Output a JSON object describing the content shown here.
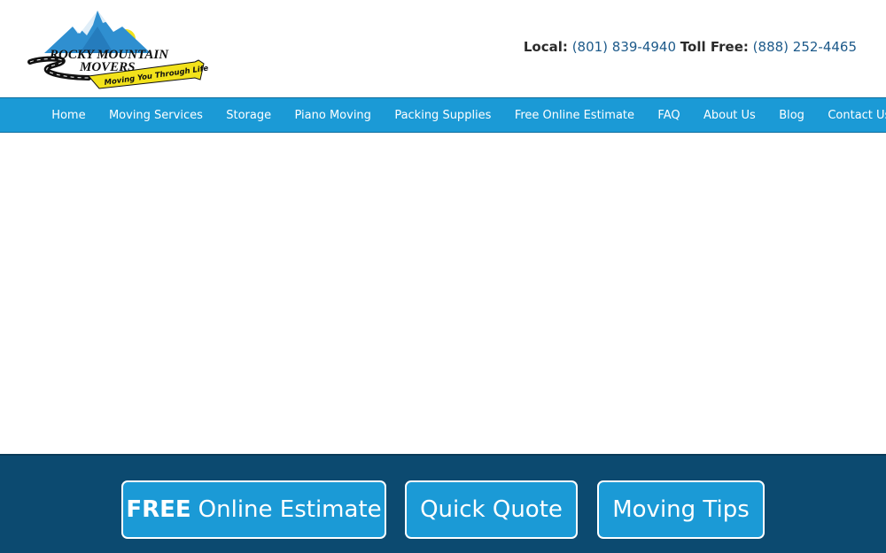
{
  "brand": {
    "logo_line1": "ROCKY MOUNTAIN",
    "logo_line2": "MOVERS",
    "tagline": "Moving You Through Life!"
  },
  "contact": {
    "local_label": "Local:",
    "local_number": "(801) 839-4940",
    "tollfree_label": "Toll Free:",
    "tollfree_number": "(888) 252-4465"
  },
  "nav": {
    "items": [
      {
        "label": "Home"
      },
      {
        "label": "Moving Services"
      },
      {
        "label": "Storage"
      },
      {
        "label": "Piano Moving"
      },
      {
        "label": "Packing Supplies"
      },
      {
        "label": "Free Online Estimate"
      },
      {
        "label": "FAQ"
      },
      {
        "label": "About Us"
      },
      {
        "label": "Blog"
      },
      {
        "label": "Contact Us"
      }
    ],
    "search_icon": "search-icon"
  },
  "cta": {
    "estimate_bold": "FREE",
    "estimate_rest": "Online Estimate",
    "quote": "Quick Quote",
    "tips": "Moving Tips"
  },
  "colors": {
    "nav_bg": "#1b9ad6",
    "cta_band_bg": "#0c4a70",
    "phone_color": "#1d5a8a"
  }
}
